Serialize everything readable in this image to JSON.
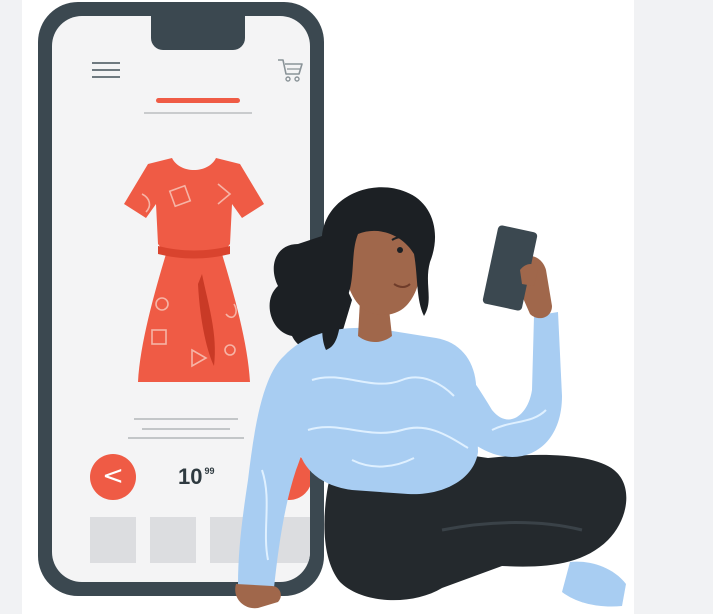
{
  "illustration": {
    "subject": "online-shopping-illustration",
    "colors": {
      "frame": "#3b4850",
      "screen": "#f4f4f5",
      "accent": "#ef5b45",
      "sweater": "#a8cdf2",
      "pants": "#24292d",
      "skin": "#a0674b",
      "hair": "#1c2024"
    }
  },
  "phone": {
    "icons": {
      "menu": "hamburger-menu-icon",
      "cart": "shopping-cart-icon",
      "prev": "chevron-left-icon"
    },
    "price": {
      "main": "10",
      "cents": "99"
    },
    "prev_label": "<",
    "thumbnails_count": 4
  }
}
